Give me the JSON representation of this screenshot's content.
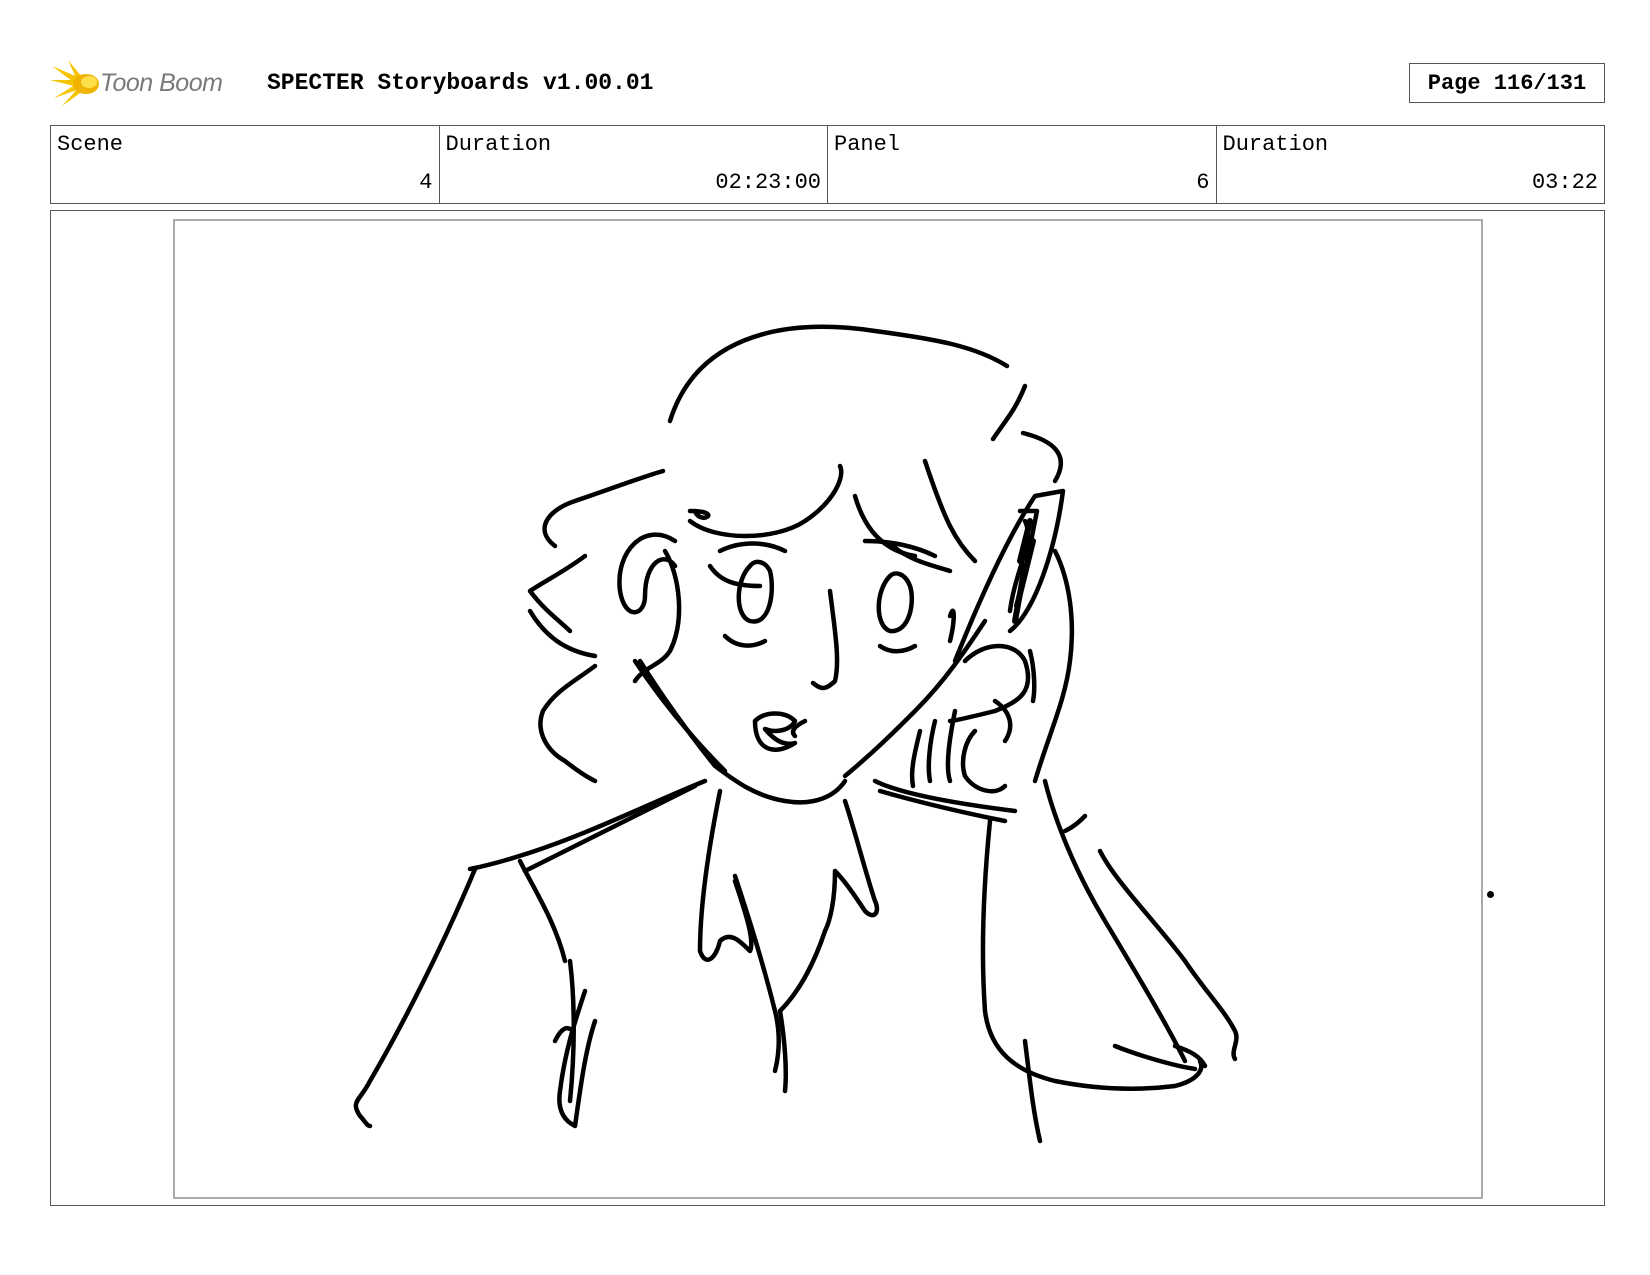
{
  "header": {
    "logo_text": "Toon Boom",
    "logo_icon": "starburst-logo-icon",
    "title": "SPECTER Storyboards v1.00.01",
    "page": "Page 116/131"
  },
  "info": {
    "scene_label": "Scene",
    "scene_value": "4",
    "scene_duration_label": "Duration",
    "scene_duration_value": "02:23:00",
    "panel_label": "Panel",
    "panel_value": "6",
    "panel_duration_label": "Duration",
    "panel_duration_value": "03:22"
  },
  "colors": {
    "logo_yellow": "#f5c400",
    "logo_text": "#7a7a7a",
    "border": "#555555",
    "image_border": "#aaaaaa"
  }
}
